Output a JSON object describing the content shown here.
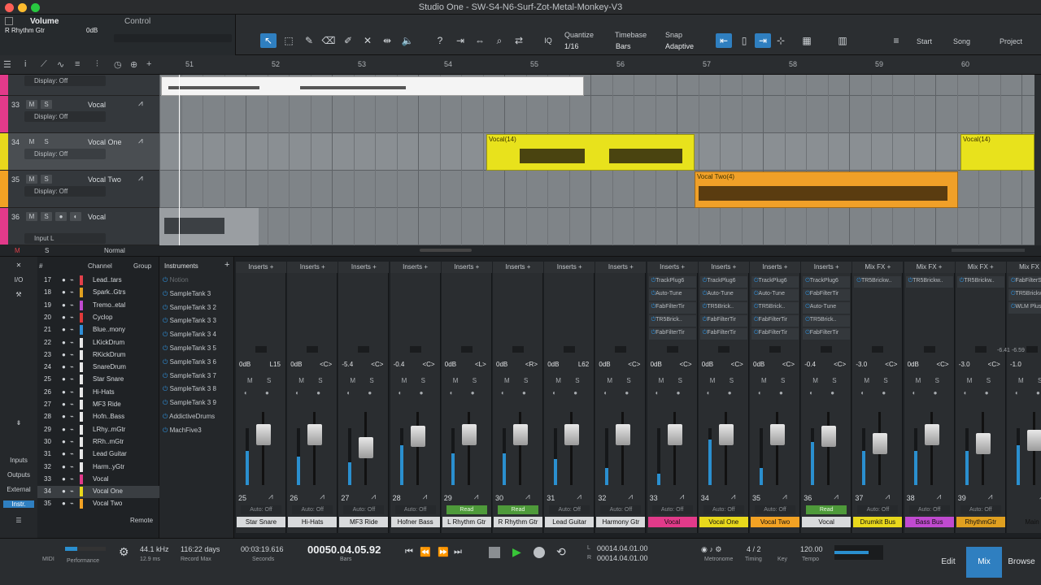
{
  "window": {
    "title": "Studio One - SW-S4-N6-Surf-Zot-Metal-Monkey-V3"
  },
  "control": {
    "param": "Volume",
    "label": "Control",
    "track": "R Rhythm Gtr",
    "value": "0dB"
  },
  "toolbar": {
    "quantize_label": "Quantize",
    "quantize_value": "1/16",
    "timebase_label": "Timebase",
    "timebase_value": "Bars",
    "snap_label": "Snap",
    "snap_value": "Adaptive",
    "start": "Start",
    "song": "Song",
    "project": "Project"
  },
  "ruler": {
    "bars": [
      "51",
      "52",
      "53",
      "54",
      "55",
      "56",
      "57",
      "58",
      "59",
      "60"
    ]
  },
  "tracks": [
    {
      "num": "33",
      "name": "Vocal",
      "display": "Display: Off",
      "color": "#e23a8a"
    },
    {
      "num": "34",
      "name": "Vocal One",
      "display": "Display: Off",
      "color": "#e8d81c"
    },
    {
      "num": "35",
      "name": "Vocal Two",
      "display": "Display: Off",
      "color": "#f2a224"
    },
    {
      "num": "36",
      "name": "Vocal",
      "display": "Input L",
      "color": "#e23a8a"
    }
  ],
  "top_partial": {
    "display": "Display: Off"
  },
  "clips": [
    {
      "name": "Vocal(14)"
    },
    {
      "name": "Vocal Two(4)"
    },
    {
      "name": "Vocal(14)"
    }
  ],
  "midbar": {
    "m": "M",
    "s": "S",
    "mode": "Normal"
  },
  "chanlist": {
    "col_num": "#",
    "col_channel": "Channel",
    "col_group": "Group",
    "rows": [
      {
        "num": "17",
        "name": "Lead..tars",
        "color": "#e2404a"
      },
      {
        "num": "18",
        "name": "Spark..Gtrs",
        "color": "#e0a020"
      },
      {
        "num": "19",
        "name": "Tremo..etal",
        "color": "#c04ad0"
      },
      {
        "num": "20",
        "name": "Cyclop",
        "color": "#e23a3a"
      },
      {
        "num": "21",
        "name": "Blue..mony",
        "color": "#2f8fd8"
      },
      {
        "num": "22",
        "name": "LKickDrum",
        "color": "#e8e8e8"
      },
      {
        "num": "23",
        "name": "RKickDrum",
        "color": "#e8e8e8"
      },
      {
        "num": "24",
        "name": "SnareDrum",
        "color": "#e8e8e8"
      },
      {
        "num": "25",
        "name": "Star Snare",
        "color": "#e8e8e8"
      },
      {
        "num": "26",
        "name": "Hi-Hats",
        "color": "#e8e8e8"
      },
      {
        "num": "27",
        "name": "MF3 Ride",
        "color": "#e8e8e8"
      },
      {
        "num": "28",
        "name": "Hofn..Bass",
        "color": "#e8e8e8"
      },
      {
        "num": "29",
        "name": "LRhy..mGtr",
        "color": "#e8e8e8"
      },
      {
        "num": "30",
        "name": "RRh..mGtr",
        "color": "#e8e8e8"
      },
      {
        "num": "31",
        "name": "Lead Guitar",
        "color": "#e8e8e8"
      },
      {
        "num": "32",
        "name": "Harm..yGtr",
        "color": "#e8e8e8"
      },
      {
        "num": "33",
        "name": "Vocal",
        "color": "#e23a8a"
      },
      {
        "num": "34",
        "name": "Vocal One",
        "color": "#e8d81c"
      },
      {
        "num": "35",
        "name": "Vocal Two",
        "color": "#f2a224"
      }
    ]
  },
  "sidebar": {
    "io": "I/O",
    "inputs": "Inputs",
    "outputs": "Outputs",
    "external": "External",
    "instr": "Instr.",
    "remote": "Remote"
  },
  "instruments": {
    "title": "Instruments",
    "items": [
      "Notion",
      "SampleTank 3",
      "SampleTank 3 2",
      "SampleTank 3 3",
      "SampleTank 3 4",
      "SampleTank 3 5",
      "SampleTank 3 6",
      "SampleTank 3 7",
      "SampleTank 3 8",
      "SampleTank 3 9",
      "AddictiveDrums",
      "MachFive3"
    ]
  },
  "strips": [
    {
      "num": "25",
      "name": "Star Snare",
      "head": "Inserts",
      "vol": "0dB",
      "pan": "L15",
      "inserts": [],
      "auto": "Auto: Off",
      "namecolor": "#d8dadc",
      "fader": 0.72,
      "meter": 0.6
    },
    {
      "num": "26",
      "name": "Hi-Hats",
      "head": "Inserts",
      "vol": "0dB",
      "pan": "<C>",
      "inserts": [],
      "auto": "Auto: Off",
      "namecolor": "#d8dadc",
      "fader": 0.72,
      "meter": 0.5
    },
    {
      "num": "27",
      "name": "MF3 Ride",
      "head": "Inserts",
      "vol": "-5.4",
      "pan": "<C>",
      "inserts": [],
      "auto": "Auto: Off",
      "namecolor": "#d8dadc",
      "fader": 0.55,
      "meter": 0.4
    },
    {
      "num": "28",
      "name": "Hofner Bass",
      "head": "Inserts",
      "vol": "-0.4",
      "pan": "<C>",
      "inserts": [],
      "auto": "Auto: Off",
      "namecolor": "#d8dadc",
      "fader": 0.7,
      "meter": 0.7
    },
    {
      "num": "29",
      "name": "L Rhythm Gtr",
      "head": "Inserts",
      "vol": "0dB",
      "pan": "<L>",
      "inserts": [],
      "auto": "Read",
      "namecolor": "#d8dadc",
      "fader": 0.72,
      "meter": 0.55
    },
    {
      "num": "30",
      "name": "R Rhythm Gtr",
      "head": "Inserts",
      "vol": "0dB",
      "pan": "<R>",
      "inserts": [],
      "auto": "Read",
      "namecolor": "#d8dadc",
      "fader": 0.72,
      "meter": 0.55
    },
    {
      "num": "31",
      "name": "Lead Guitar",
      "head": "Inserts",
      "vol": "0dB",
      "pan": "L62",
      "inserts": [],
      "auto": "Auto: Off",
      "namecolor": "#d8dadc",
      "fader": 0.72,
      "meter": 0.45
    },
    {
      "num": "32",
      "name": "Harmony Gtr",
      "head": "Inserts",
      "vol": "0dB",
      "pan": "<C>",
      "inserts": [],
      "auto": "Auto: Off",
      "namecolor": "#d8dadc",
      "fader": 0.72,
      "meter": 0.3
    },
    {
      "num": "33",
      "name": "Vocal",
      "head": "Inserts",
      "vol": "0dB",
      "pan": "<C>",
      "inserts": [
        "TrackPlug6",
        "Auto-Tune",
        "FabFilterTir",
        "TR5Brick..",
        "FabFilterTir"
      ],
      "auto": "Auto: Off",
      "namecolor": "#e23a8a",
      "fader": 0.72,
      "meter": 0.2
    },
    {
      "num": "34",
      "name": "Vocal One",
      "head": "Inserts",
      "vol": "0dB",
      "pan": "<C>",
      "inserts": [
        "TrackPlug6",
        "Auto-Tune",
        "TR5Brick..",
        "FabFilterTir",
        "FabFilterTir"
      ],
      "auto": "Auto: Off",
      "namecolor": "#e8d81c",
      "fader": 0.72,
      "meter": 0.8
    },
    {
      "num": "35",
      "name": "Vocal Two",
      "head": "Inserts",
      "vol": "0dB",
      "pan": "<C>",
      "inserts": [
        "TrackPlug6",
        "Auto-Tune",
        "TR5Brick..",
        "FabFilterTir",
        "FabFilterTir"
      ],
      "auto": "Auto: Off",
      "namecolor": "#f2a224",
      "fader": 0.72,
      "meter": 0.3
    },
    {
      "num": "36",
      "name": "Vocal",
      "head": "Inserts",
      "vol": "-0.4",
      "pan": "<C>",
      "inserts": [
        "TrackPlug6",
        "FabFilterTir",
        "Auto-Tune",
        "TR5Brick..",
        "FabFilterTir"
      ],
      "auto": "Read",
      "namecolor": "#d8dadc",
      "fader": 0.7,
      "meter": 0.75
    },
    {
      "num": "37",
      "name": "Drumkit Bus",
      "head": "Mix FX",
      "vol": "-3.0",
      "pan": "<C>",
      "inserts": [
        "TR5Brickw.."
      ],
      "auto": "Auto: Off",
      "namecolor": "#e8d81c",
      "fader": 0.6,
      "meter": 0.6
    },
    {
      "num": "38",
      "name": "Bass Bus",
      "head": "Mix FX",
      "vol": "0dB",
      "pan": "<C>",
      "inserts": [
        "TR5Brickw.."
      ],
      "auto": "Auto: Off",
      "namecolor": "#c04ad0",
      "fader": 0.72,
      "meter": 0.6
    },
    {
      "num": "39",
      "name": "RhythmGtr",
      "head": "Mix FX",
      "vol": "-3.0",
      "pan": "<C>",
      "inserts": [
        "TR5Brickw.."
      ],
      "auto": "Auto: Off",
      "namecolor": "#e0a020",
      "fader": 0.6,
      "meter": 0.6
    },
    {
      "num": "",
      "name": "Main",
      "head": "Mix FX",
      "vol": "-1.0",
      "pan": "",
      "inserts": [
        "FabFilterSat",
        "TR5Brickw..",
        "WLM Plus (s)"
      ],
      "auto": "",
      "namecolor": "#2a2d30",
      "fader": 0.65,
      "meter": 0.7
    }
  ],
  "main_peaks": "-6.41  -6.59",
  "transport": {
    "midi": "MIDI",
    "performance": "Performance",
    "rate": "44.1 kHz",
    "rate_sub": "12.9 ms",
    "record_max": "116:22 days",
    "record_max_label": "Record Max",
    "seconds": "00:03:19.616",
    "seconds_label": "Seconds",
    "bars": "00050.04.05.92",
    "bars_label": "Bars",
    "loop_l": "00014.04.01.00",
    "loop_r": "00014.04.01.00",
    "metronome": "Metronome",
    "timing": "4 / 2",
    "timing_label": "Timing",
    "key_label": "Key",
    "tempo": "120.00",
    "tempo_label": "Tempo",
    "edit": "Edit",
    "mix": "Mix",
    "browse": "Browse"
  }
}
